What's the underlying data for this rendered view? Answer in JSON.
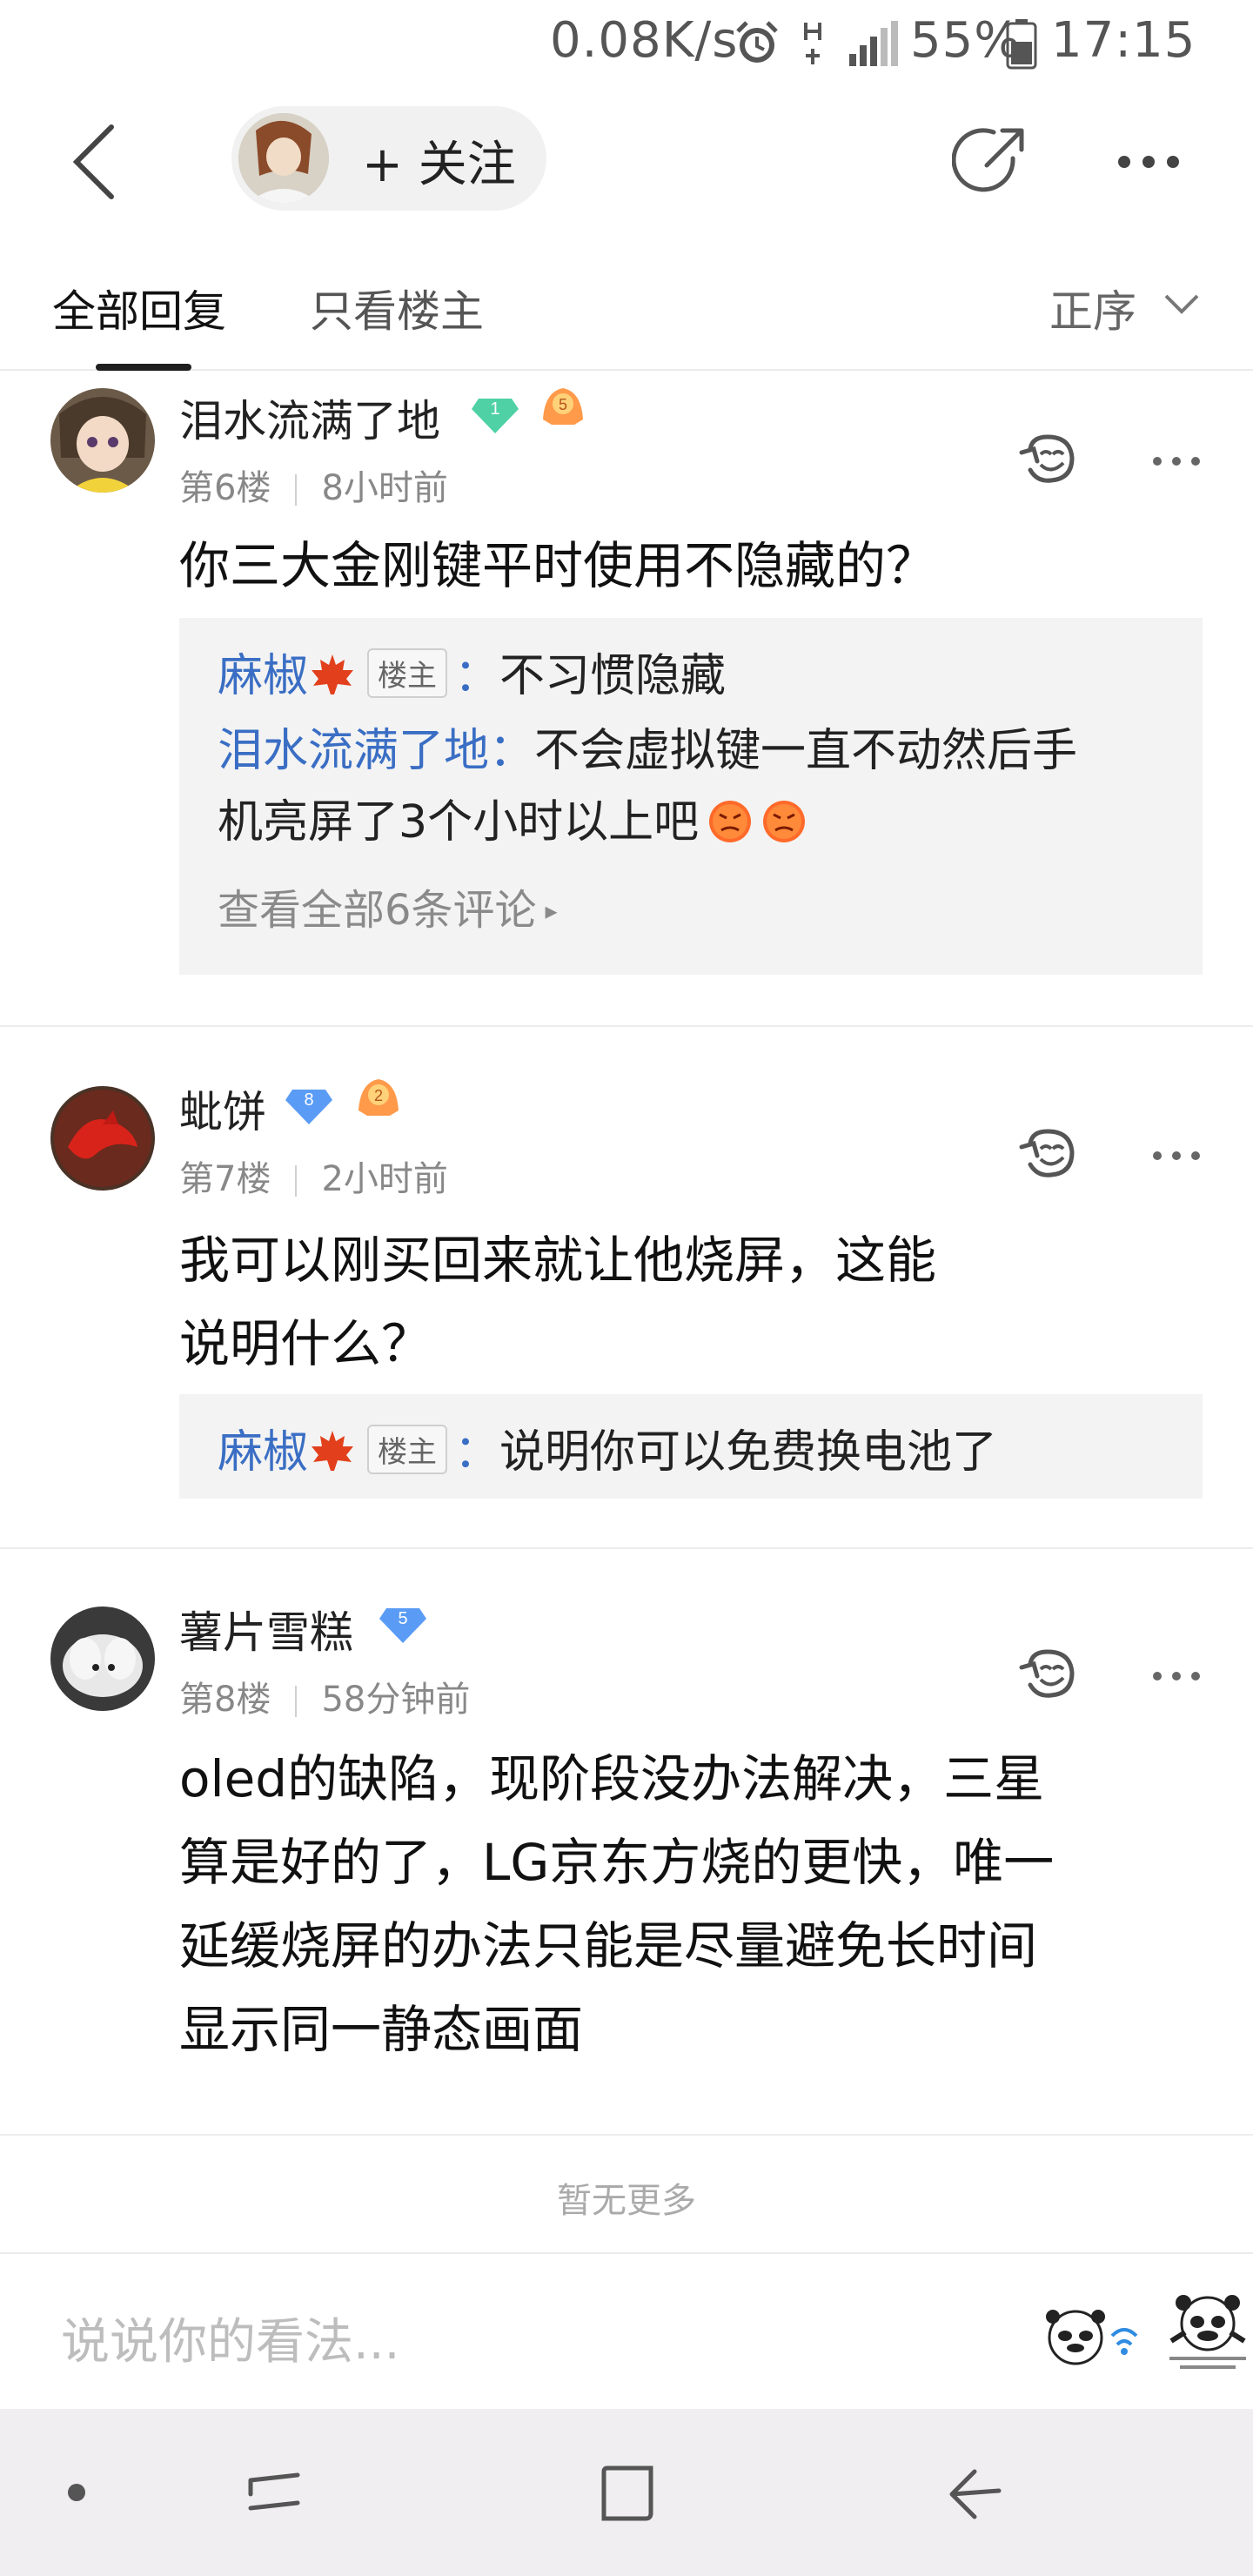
{
  "status_bar": {
    "speed": "0.08K/s",
    "battery_percent": "55%",
    "time": "17:15",
    "icons": [
      "alarm-icon",
      "h-plus-icon",
      "signal-icon",
      "battery-icon"
    ]
  },
  "nav": {
    "follow_label": "+ 关注",
    "icons": [
      "back-arrow-icon",
      "share-icon",
      "more-dots-icon"
    ]
  },
  "tabs": {
    "all": "全部回复",
    "owner_only": "只看楼主",
    "sort": "正序"
  },
  "posts": [
    {
      "username": "泪水流满了地",
      "level": "1",
      "badge": "5",
      "floor": "第6楼",
      "time": "8小时前",
      "content": [
        "你三大金刚键平时使用不隐藏的？"
      ],
      "replies": [
        {
          "name": "麻椒",
          "owner_tag": "楼主",
          "colon": "：",
          "text": "不习惯隐藏"
        },
        {
          "name": "泪水流满了地",
          "colon": "：",
          "text": "不会虚拟键一直不动然后手",
          "text2": "机亮屏了3个小时以上吧"
        }
      ],
      "view_all": "查看全部6条评论"
    },
    {
      "username": "蚍饼",
      "level": "8",
      "badge": "2",
      "floor": "第7楼",
      "time": "2小时前",
      "content": [
        "我可以刚买回来就让他烧屏，这能",
        "说明什么？"
      ],
      "replies": [
        {
          "name": "麻椒",
          "owner_tag": "楼主",
          "colon": "：",
          "text": "说明你可以免费换电池了"
        }
      ]
    },
    {
      "username": "薯片雪糕",
      "level": "5",
      "floor": "第8楼",
      "time": "58分钟前",
      "content": [
        "oled的缺陷，现阶段没办法解决，三星",
        "算是好的了，LG京东方烧的更快，唯一",
        "延缓烧屏的办法只能是尽量避免长时间",
        "显示同一静态画面"
      ]
    }
  ],
  "footer": {
    "no_more": "暂无更多",
    "comment_placeholder": "说说你的看法..."
  },
  "colors": {
    "link_blue": "#3a6ec4",
    "sub_box_bg": "#f3f3f3",
    "level_green": "#4fd1a5",
    "level_blue": "#5a9cf5",
    "badge_orange": "#ff9a4a"
  }
}
